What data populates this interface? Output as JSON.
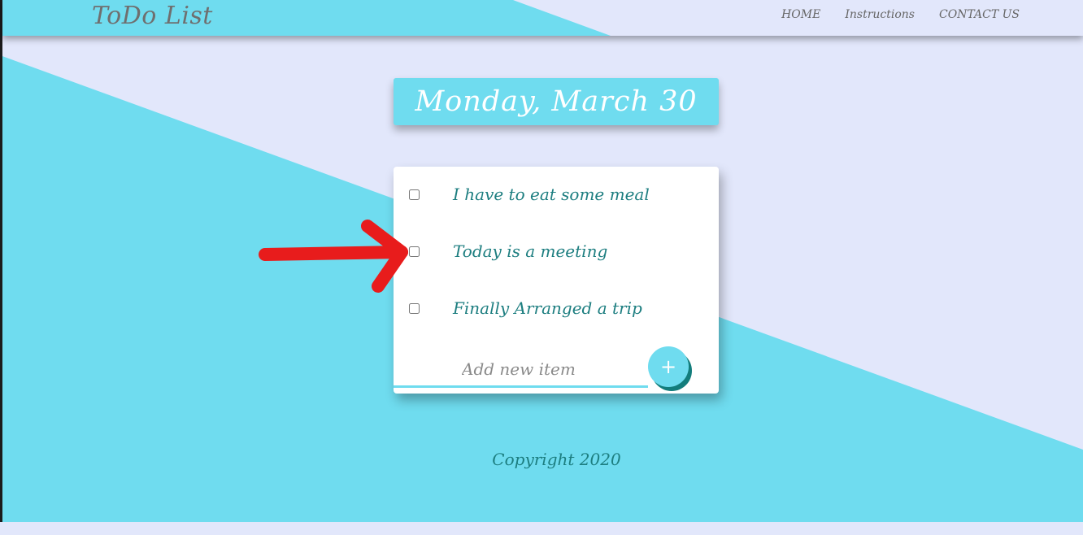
{
  "header": {
    "brand": "ToDo List",
    "nav": [
      {
        "label": "HOME"
      },
      {
        "label": "Instructions"
      },
      {
        "label": "CONTACT US"
      }
    ]
  },
  "date_heading": "Monday, March 30",
  "todo": {
    "items": [
      {
        "text": "I have to eat some meal",
        "checked": false
      },
      {
        "text": "Today is a meeting",
        "checked": false
      },
      {
        "text": "Finally Arranged a trip",
        "checked": false
      }
    ],
    "add_placeholder": "Add new item",
    "add_button_label": "+"
  },
  "footer": {
    "copyright": "Copyright 2020"
  },
  "colors": {
    "accent": "#6fdcef",
    "background": "#e2e7fb",
    "text_teal": "#1d7e80",
    "annotation_red": "#e81c1c"
  }
}
